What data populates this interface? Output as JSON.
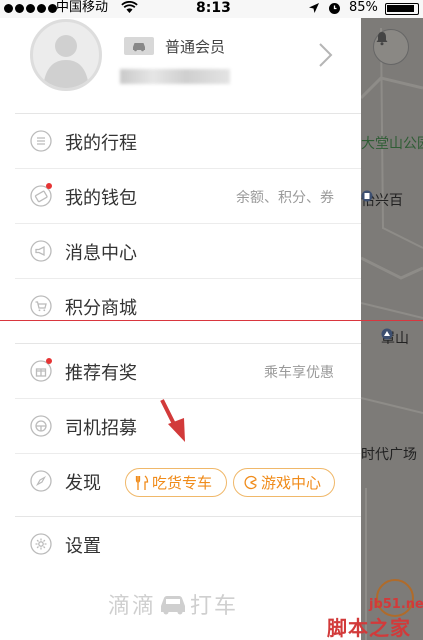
{
  "status_bar": {
    "carrier": "中国移动",
    "time": "8:13",
    "battery_percent": "85%",
    "battery_level": 0.85
  },
  "profile": {
    "member_level": "普通会员"
  },
  "menu": {
    "items": [
      {
        "label": "我的行程",
        "icon": "list-icon",
        "aux": "",
        "badge": false
      },
      {
        "label": "我的钱包",
        "icon": "wallet-icon",
        "aux": "余额、积分、券",
        "badge": true
      },
      {
        "label": "消息中心",
        "icon": "megaphone-icon",
        "aux": "",
        "badge": false
      },
      {
        "label": "积分商城",
        "icon": "cart-icon",
        "aux": "",
        "badge": false
      },
      {
        "label": "推荐有奖",
        "icon": "gift-icon",
        "aux": "乘车享优惠",
        "badge": true
      },
      {
        "label": "司机招募",
        "icon": "steering-wheel-icon",
        "aux": "",
        "badge": false
      },
      {
        "label": "发现",
        "icon": "compass-icon",
        "aux": "",
        "badge": false
      },
      {
        "label": "设置",
        "icon": "gear-icon",
        "aux": "",
        "badge": false
      }
    ],
    "discover_pills": [
      {
        "label": "吃货专车",
        "icon": "fork-knife-icon"
      },
      {
        "label": "游戏中心",
        "icon": "game-icon"
      }
    ]
  },
  "brand": {
    "left": "滴滴",
    "right": "打车",
    "icon": "taxi-icon"
  },
  "map": {
    "labels": [
      "大堂山公园",
      "怡兴百",
      "罩山",
      "时代广场"
    ]
  },
  "watermark": {
    "site": "jb51.net",
    "name": "脚本之家"
  },
  "colors": {
    "accent_orange": "#f08b1a",
    "badge_red": "#e63434",
    "map_overlay": "#7d7b78"
  }
}
